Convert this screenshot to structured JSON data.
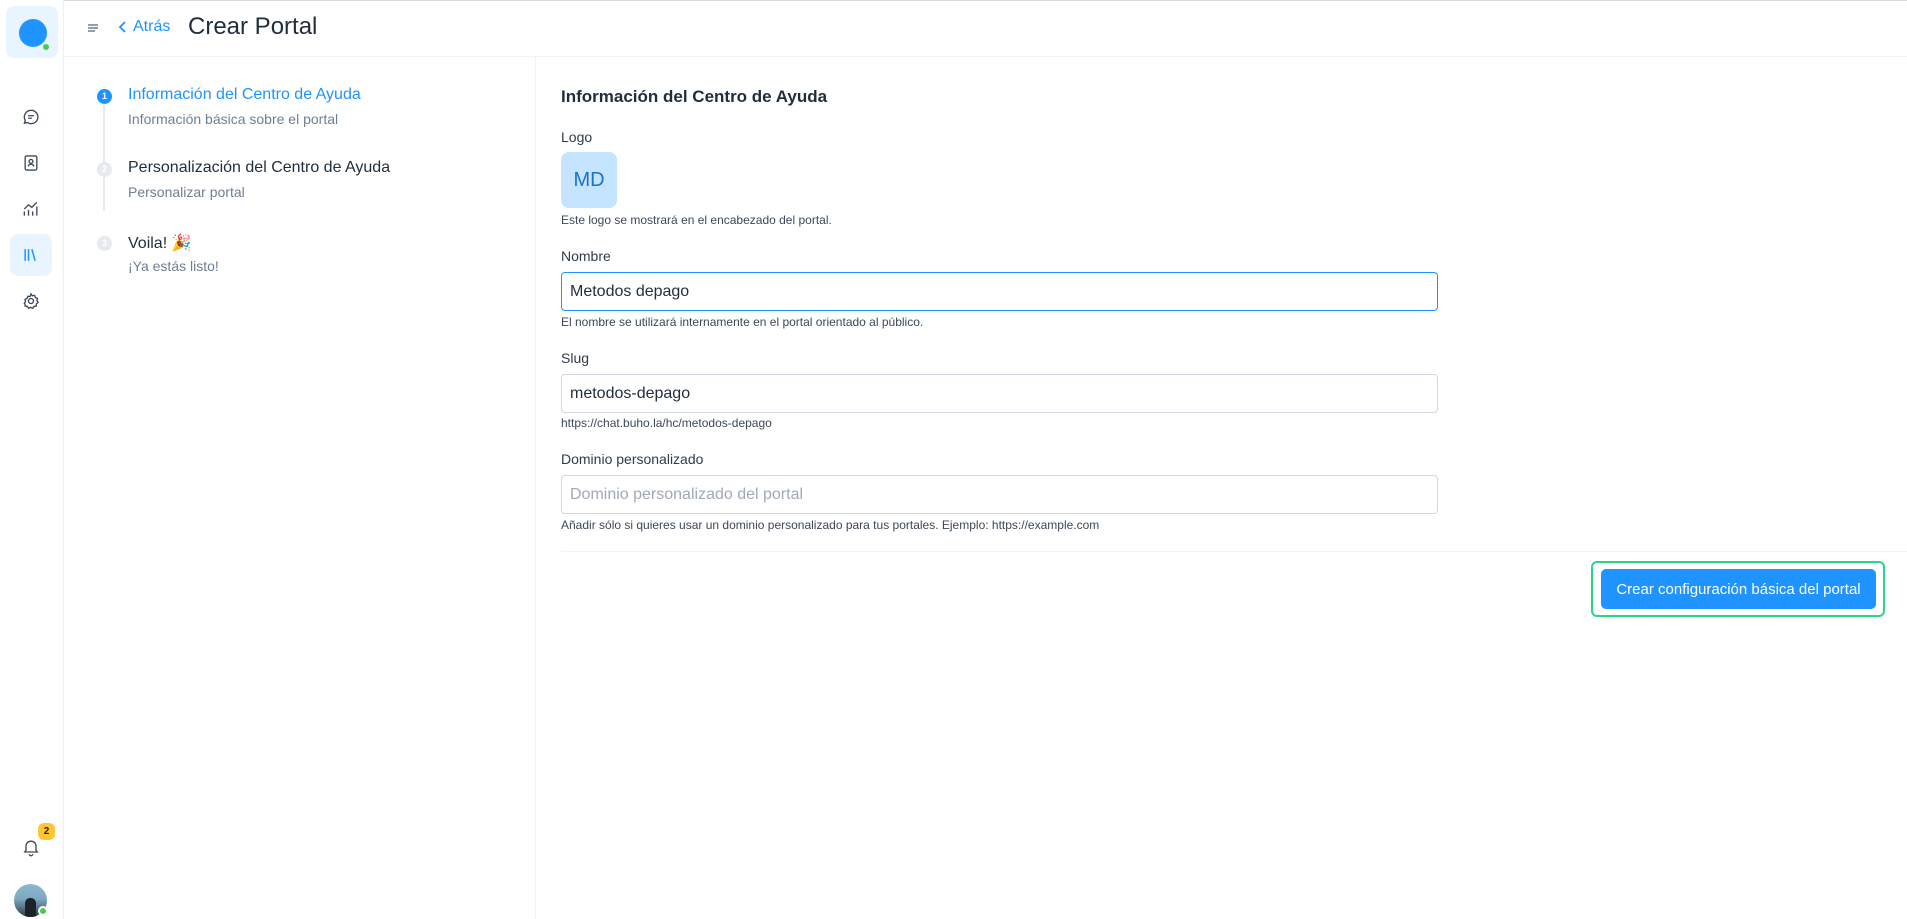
{
  "header": {
    "back_label": "Atrás",
    "title": "Crear Portal"
  },
  "sidebar": {
    "items": [
      {
        "icon": "chat-bubble-icon",
        "active": false
      },
      {
        "icon": "contacts-book-icon",
        "active": false
      },
      {
        "icon": "reports-chart-icon",
        "active": false
      },
      {
        "icon": "library-books-icon",
        "active": true
      },
      {
        "icon": "gear-icon",
        "active": false
      }
    ],
    "notifications_count": "2",
    "accent_color": "#1f93ff"
  },
  "steps": [
    {
      "number": "1",
      "title": "Información del Centro de Ayuda",
      "subtitle": "Información básica sobre el portal",
      "active": true
    },
    {
      "number": "2",
      "title": "Personalización del Centro de Ayuda",
      "subtitle": "Personalizar portal",
      "active": false
    },
    {
      "number": "3",
      "title": "Voila! 🎉",
      "subtitle": "¡Ya estás listo!",
      "active": false
    }
  ],
  "form": {
    "section_title": "Información del Centro de Ayuda",
    "logo": {
      "label": "Logo",
      "initials": "MD",
      "help": "Este logo se mostrará en el encabezado del portal."
    },
    "name": {
      "label": "Nombre",
      "value": "Metodos depago",
      "help": "El nombre se utilizará internamente en el portal orientado al público."
    },
    "slug": {
      "label": "Slug",
      "value": "metodos-depago",
      "help": "https://chat.buho.la/hc/metodos-depago"
    },
    "custom_domain": {
      "label": "Dominio personalizado",
      "value": "",
      "placeholder": "Dominio personalizado del portal",
      "help": "Añadir sólo si quieres usar un dominio personalizado para tus portales. Ejemplo: https://example.com"
    },
    "submit_label": "Crear configuración básica del portal"
  }
}
